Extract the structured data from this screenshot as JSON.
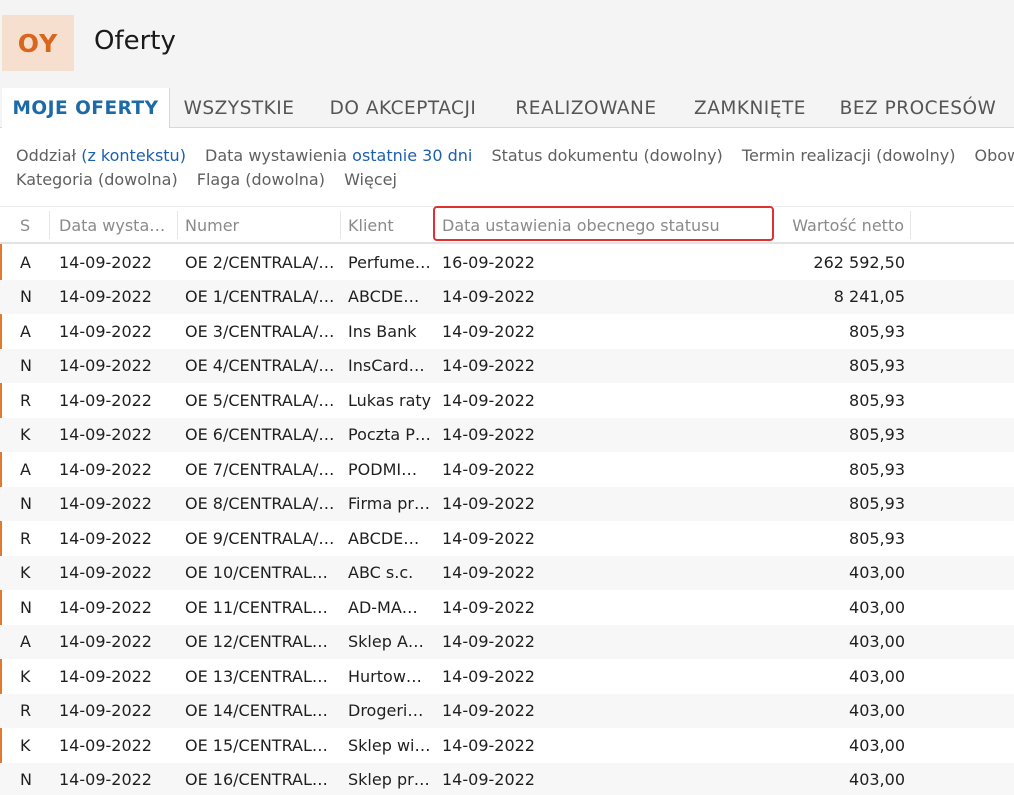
{
  "app": {
    "badge": "OY",
    "title": "Oferty",
    "accent": "#e07a2e"
  },
  "tabs": [
    {
      "label": "MOJE OFERTY",
      "active": true
    },
    {
      "label": "WSZYSTKIE",
      "active": false
    },
    {
      "label": "DO AKCEPTACJI",
      "active": false
    },
    {
      "label": "REALIZOWANE",
      "active": false
    },
    {
      "label": "ZAMKNIĘTE",
      "active": false
    },
    {
      "label": "BEZ PROCESÓW",
      "active": false
    }
  ],
  "filters": {
    "oddzial_label": "Oddział",
    "oddzial_value": "(z kontekstu)",
    "data_label": "Data wystawienia",
    "data_value": "ostatnie 30 dni",
    "status": "Status dokumentu (dowolny)",
    "termin": "Termin realizacji (dowolny)",
    "obowiazuje": "Obowią",
    "kategoria": "Kategoria (dowolna)",
    "flaga": "Flaga (dowolna)",
    "wiecej": "Więcej"
  },
  "columns": {
    "s": "S",
    "date": "Data wysta…",
    "num": "Numer",
    "client": "Klient",
    "status_date": "Data ustawienia obecnego statusu",
    "value": "Wartość netto"
  },
  "rows": [
    {
      "s": "A",
      "date": "14-09-2022",
      "num": "OE 2/CENTRALA/…",
      "client": "Perfume…",
      "sdate": "16-09-2022",
      "value": "262 592,50"
    },
    {
      "s": "N",
      "date": "14-09-2022",
      "num": "OE 1/CENTRALA/…",
      "client": "ABCDE…",
      "sdate": "14-09-2022",
      "value": "8 241,05"
    },
    {
      "s": "A",
      "date": "14-09-2022",
      "num": "OE 3/CENTRALA/…",
      "client": "Ins Bank",
      "sdate": "14-09-2022",
      "value": "805,93"
    },
    {
      "s": "N",
      "date": "14-09-2022",
      "num": "OE 4/CENTRALA/…",
      "client": "InsCard…",
      "sdate": "14-09-2022",
      "value": "805,93"
    },
    {
      "s": "R",
      "date": "14-09-2022",
      "num": "OE 5/CENTRALA/…",
      "client": "Lukas raty",
      "sdate": "14-09-2022",
      "value": "805,93"
    },
    {
      "s": "K",
      "date": "14-09-2022",
      "num": "OE 6/CENTRALA/…",
      "client": "Poczta P…",
      "sdate": "14-09-2022",
      "value": "805,93"
    },
    {
      "s": "A",
      "date": "14-09-2022",
      "num": "OE 7/CENTRALA/…",
      "client": "PODMI…",
      "sdate": "14-09-2022",
      "value": "805,93"
    },
    {
      "s": "N",
      "date": "14-09-2022",
      "num": "OE 8/CENTRALA/…",
      "client": "Firma pr…",
      "sdate": "14-09-2022",
      "value": "805,93"
    },
    {
      "s": "R",
      "date": "14-09-2022",
      "num": "OE 9/CENTRALA/…",
      "client": "ABCDE…",
      "sdate": "14-09-2022",
      "value": "805,93"
    },
    {
      "s": "K",
      "date": "14-09-2022",
      "num": "OE 10/CENTRAL…",
      "client": "ABC s.c.",
      "sdate": "14-09-2022",
      "value": "403,00"
    },
    {
      "s": "N",
      "date": "14-09-2022",
      "num": "OE 11/CENTRAL…",
      "client": "AD-MA…",
      "sdate": "14-09-2022",
      "value": "403,00"
    },
    {
      "s": "A",
      "date": "14-09-2022",
      "num": "OE 12/CENTRAL…",
      "client": "Sklep A…",
      "sdate": "14-09-2022",
      "value": "403,00"
    },
    {
      "s": "K",
      "date": "14-09-2022",
      "num": "OE 13/CENTRAL…",
      "client": "Hurtow…",
      "sdate": "14-09-2022",
      "value": "403,00"
    },
    {
      "s": "R",
      "date": "14-09-2022",
      "num": "OE 14/CENTRAL…",
      "client": "Drogeri…",
      "sdate": "14-09-2022",
      "value": "403,00"
    },
    {
      "s": "K",
      "date": "14-09-2022",
      "num": "OE 15/CENTRAL…",
      "client": "Sklep wi…",
      "sdate": "14-09-2022",
      "value": "403,00"
    },
    {
      "s": "N",
      "date": "14-09-2022",
      "num": "OE 16/CENTRAL…",
      "client": "Sklep pr…",
      "sdate": "14-09-2022",
      "value": "403,00"
    }
  ]
}
